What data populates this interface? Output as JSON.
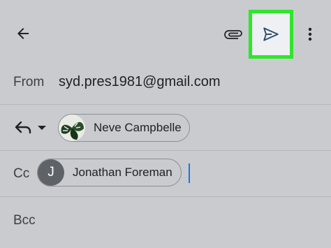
{
  "toolbar": {
    "back_icon": "arrow-back-icon",
    "attach_icon": "paperclip-icon",
    "send_icon": "send-icon",
    "more_icon": "more-vertical-icon",
    "highlight_color": "#2ee62a"
  },
  "from": {
    "label": "From",
    "value": "syd.pres1981@gmail.com"
  },
  "to": {
    "reply_icon": "reply-icon",
    "caret_icon": "caret-down-icon",
    "recipient": {
      "name": "Neve Campbelle",
      "avatar_icon": "monstera-leaf-avatar"
    }
  },
  "cc": {
    "label": "Cc",
    "recipient": {
      "initial": "J",
      "name": "Jonathan Foreman"
    }
  },
  "bcc": {
    "label": "Bcc"
  }
}
